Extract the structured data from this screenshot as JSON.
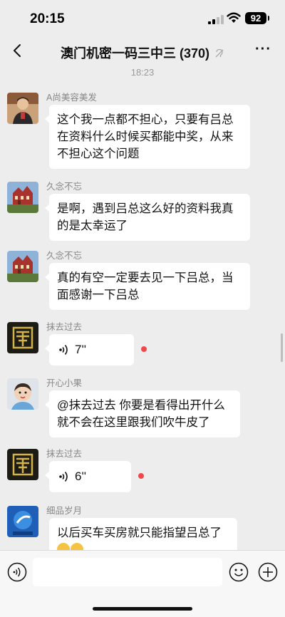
{
  "status": {
    "time": "20:15",
    "battery": "92"
  },
  "nav": {
    "title": "澳门机密一码三中三 (370)"
  },
  "timestamp": "18:23",
  "messages": [
    {
      "sender": "A尚美容美发",
      "lines": [
        "这个我一点都不担心，只要有吕总",
        "在资料什么时候买都能中奖，从来",
        "不担心这个问题"
      ]
    },
    {
      "sender": "久念不忘",
      "lines": [
        "是啊，遇到吕总这么好的资料我真",
        "的是太幸运了"
      ]
    },
    {
      "sender": "久念不忘",
      "lines": [
        "真的有空一定要去见一下吕总，当",
        "面感谢一下吕总"
      ]
    },
    {
      "sender": "抹去过去",
      "voice": "7''"
    },
    {
      "sender": "开心小果",
      "lines": [
        "@抹去过去 你要是看得出开什么",
        "就不会在这里跟我们吹牛皮了"
      ]
    },
    {
      "sender": "抹去过去",
      "voice": "6''"
    },
    {
      "sender": "细品岁月",
      "lines": [
        "以后买车买房就只能指望吕总了"
      ]
    }
  ],
  "colors": {
    "background": "#ededed",
    "bubble": "#ffffff",
    "unread": "#f04848"
  },
  "icons": [
    "back-icon",
    "mute-icon",
    "more-icon",
    "voice-toggle-icon",
    "emoji-icon",
    "plus-icon"
  ]
}
